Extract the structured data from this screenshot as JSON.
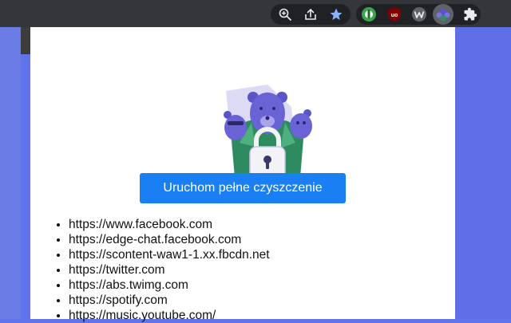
{
  "browser": {
    "toolbar_icons": [
      {
        "name": "zoom-icon",
        "glyph": "⌕"
      },
      {
        "name": "share-icon",
        "glyph": "⇪"
      },
      {
        "name": "bookmark-star-icon",
        "glyph": "★"
      }
    ],
    "extensions": [
      {
        "name": "extension-green-icon"
      },
      {
        "name": "ublock-icon",
        "label": "uo"
      },
      {
        "name": "extension-w-icon",
        "label": "W"
      },
      {
        "name": "bears-extension-icon"
      },
      {
        "name": "extensions-puzzle-icon"
      }
    ],
    "colors": {
      "star": "#8ab4f8",
      "bar": "#35363a",
      "pill": "#202124"
    }
  },
  "popup": {
    "hero_icon": "bears-lock-illustration",
    "action_button_label": "Uruchom pełne czyszczenie",
    "urls": [
      "https://www.facebook.com",
      "https://edge-chat.facebook.com",
      "https://scontent-waw1-1.xx.fbcdn.net",
      "https://twitter.com",
      "https://abs.twimg.com",
      "https://spotify.com",
      "https://music.youtube.com/"
    ],
    "colors": {
      "button": "#1a7ff3",
      "bear": "#5b54c9",
      "leaves": "#2e8a5f"
    }
  }
}
